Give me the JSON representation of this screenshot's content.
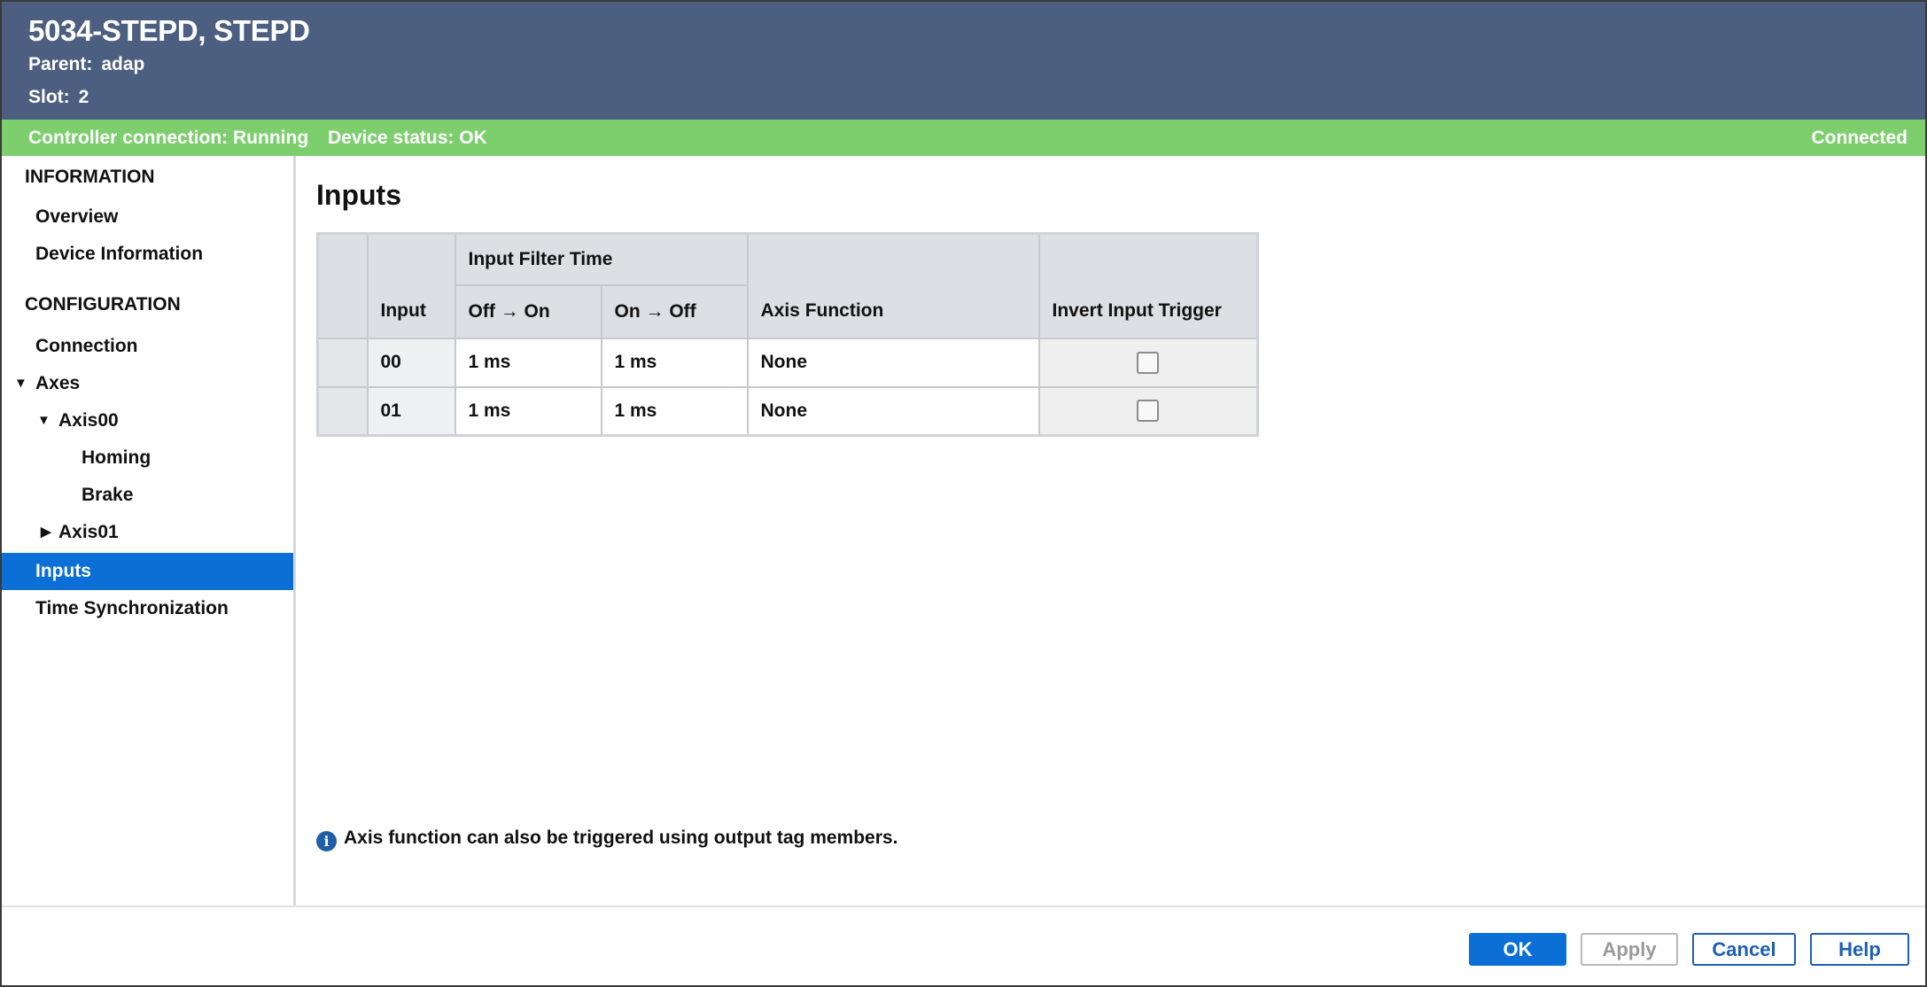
{
  "header": {
    "title": "5034-STEPD, STEPD",
    "parent_label": "Parent:",
    "parent_value": "adap",
    "slot_label": "Slot:",
    "slot_value": "2"
  },
  "status": {
    "controller_label": "Controller connection:",
    "controller_value": "Running",
    "device_label": "Device status:",
    "device_value": "OK",
    "connection": "Connected",
    "bar_color": "#7dcf6e"
  },
  "sidebar": {
    "information_heading": "INFORMATION",
    "overview": "Overview",
    "device_information": "Device Information",
    "configuration_heading": "CONFIGURATION",
    "connection": "Connection",
    "axes": "Axes",
    "axis00": "Axis00",
    "homing": "Homing",
    "brake": "Brake",
    "axis01": "Axis01",
    "inputs": "Inputs",
    "time_sync": "Time Synchronization"
  },
  "main": {
    "title": "Inputs",
    "table": {
      "col_input": "Input",
      "group_filter": "Input Filter Time",
      "col_off_on": "Off → On",
      "col_on_off": "On → Off",
      "col_axis_function": "Axis Function",
      "col_invert": "Invert Input Trigger",
      "rows": [
        {
          "input": "00",
          "off_on": "1 ms",
          "on_off": "1 ms",
          "axis_function": "None",
          "invert": false
        },
        {
          "input": "01",
          "off_on": "1 ms",
          "on_off": "1 ms",
          "axis_function": "None",
          "invert": false
        }
      ]
    },
    "note": "Axis function can also be triggered using output tag members.",
    "note_icon": "info-icon"
  },
  "footer": {
    "ok": "OK",
    "apply": "Apply",
    "cancel": "Cancel",
    "help": "Help"
  },
  "colors": {
    "header": "#4d5f80",
    "accent": "#0b6fd6"
  }
}
